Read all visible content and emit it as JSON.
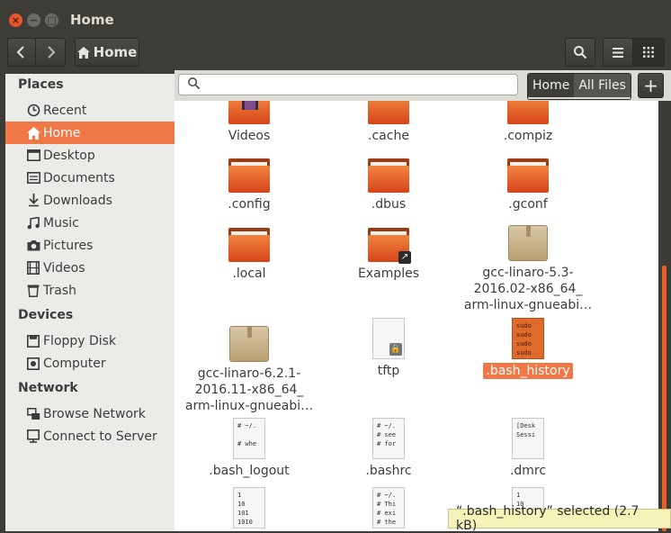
{
  "window": {
    "title": "Home",
    "close_glyph": "×",
    "minimize_glyph": "−",
    "maximize_glyph": "□"
  },
  "toolbar": {
    "path_label": "Home"
  },
  "sidebar": {
    "places_header": "Places",
    "places": [
      {
        "label": "Recent",
        "icon": "clock-icon"
      },
      {
        "label": "Home",
        "icon": "home-icon",
        "active": true
      },
      {
        "label": "Desktop",
        "icon": "desktop-folder-icon"
      },
      {
        "label": "Documents",
        "icon": "document-icon"
      },
      {
        "label": "Downloads",
        "icon": "download-icon"
      },
      {
        "label": "Music",
        "icon": "music-icon"
      },
      {
        "label": "Pictures",
        "icon": "camera-icon"
      },
      {
        "label": "Videos",
        "icon": "film-icon"
      },
      {
        "label": "Trash",
        "icon": "trash-icon"
      }
    ],
    "devices_header": "Devices",
    "devices": [
      {
        "label": "Floppy Disk",
        "icon": "floppy-icon"
      },
      {
        "label": "Computer",
        "icon": "computer-icon"
      }
    ],
    "network_header": "Network",
    "network": [
      {
        "label": "Browse Network",
        "icon": "network-icon"
      },
      {
        "label": "Connect to Server",
        "icon": "server-icon"
      }
    ]
  },
  "location": {
    "search_placeholder": "",
    "scope_home": "Home",
    "scope_all": "All Files",
    "add_label": "+"
  },
  "files": [
    {
      "name": "Videos",
      "type": "folder-video"
    },
    {
      "name": ".cache",
      "type": "folder"
    },
    {
      "name": ".compiz",
      "type": "folder"
    },
    {
      "name": ".config",
      "type": "folder"
    },
    {
      "name": ".dbus",
      "type": "folder"
    },
    {
      "name": ".gconf",
      "type": "folder"
    },
    {
      "name": ".local",
      "type": "folder"
    },
    {
      "name": "Examples",
      "type": "folder-link"
    },
    {
      "name_lines": [
        "gcc-linaro-5.3-",
        "2016.02-x86_64_",
        "arm-linux-gnueabi…"
      ],
      "type": "archive"
    },
    {
      "name_lines": [
        "gcc-linaro-6.2.1-",
        "2016.11-x86_64_",
        "arm-linux-gnueabi…"
      ],
      "type": "archive"
    },
    {
      "name": "tftp",
      "type": "locked-doc"
    },
    {
      "name": ".bash_history",
      "type": "doc-orange",
      "selected": true,
      "preview": "sudo\nsudo\nsudo\nsudo"
    },
    {
      "name": ".bash_logout",
      "type": "doc",
      "preview": "# ~/.\n\n# whe"
    },
    {
      "name": ".bashrc",
      "type": "doc",
      "preview": "# ~/.\n# see\n# for"
    },
    {
      "name": ".dmrc",
      "type": "doc",
      "preview": "[Desk\nSessi"
    },
    {
      "name": "",
      "type": "doc",
      "preview": "1\n10\n101\n1010"
    },
    {
      "name": "",
      "type": "doc",
      "preview": "# ~/.\n# Thi\n# exi\n# the"
    },
    {
      "name": "",
      "type": "doc",
      "preview": "1\n10\n101\n1010"
    }
  ],
  "status": {
    "text": "“.bash_history” selected  (2.7 kB)"
  }
}
